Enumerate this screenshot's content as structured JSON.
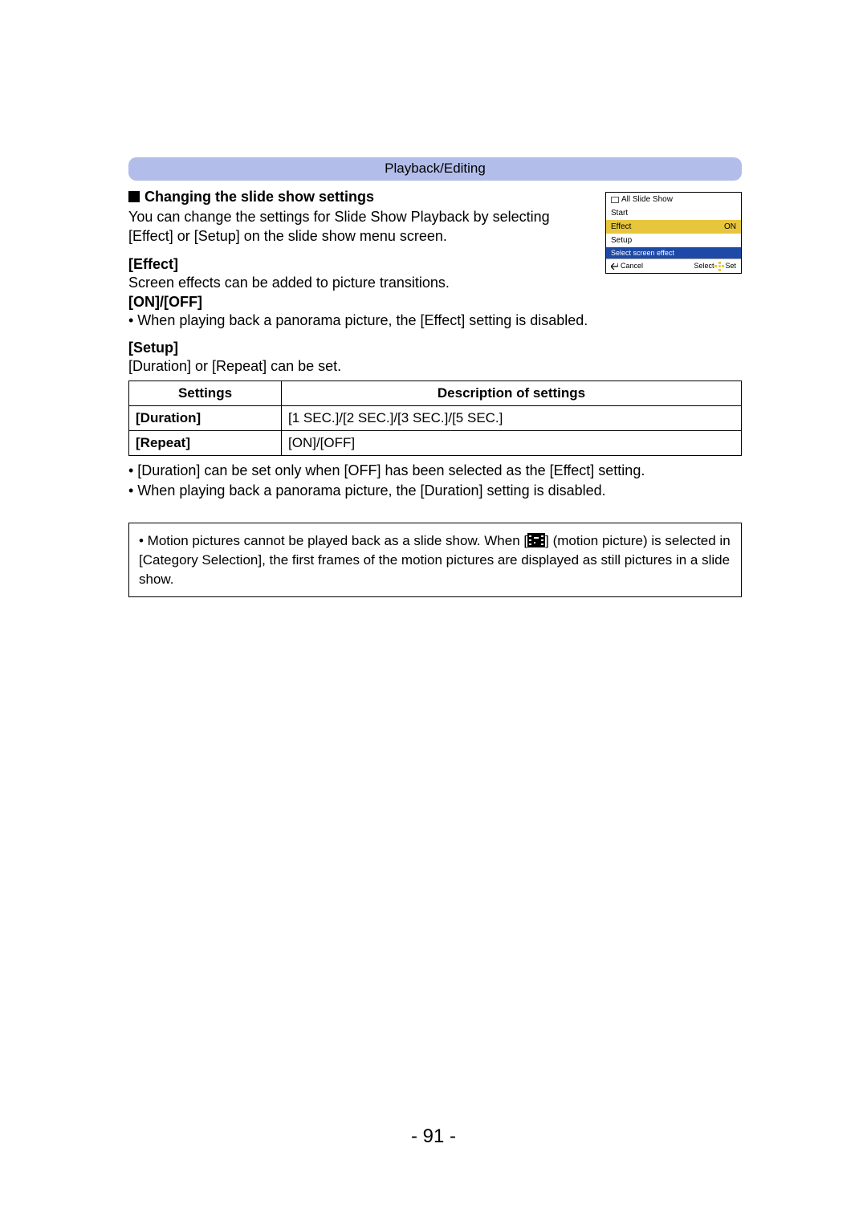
{
  "header": {
    "title": "Playback/Editing"
  },
  "heading1": "Changing the slide show settings",
  "intro": "You can change the settings for Slide Show Playback by selecting [Effect] or [Setup] on the slide show menu screen.",
  "effect": {
    "title": "[Effect]",
    "desc": "Screen effects can be added to picture transitions.",
    "options": "[ON]/[OFF]",
    "note": "• When playing back a panorama picture, the [Effect] setting is disabled."
  },
  "setup": {
    "title": "[Setup]",
    "desc": "[Duration] or [Repeat] can be set."
  },
  "table": {
    "headers": {
      "settings": "Settings",
      "desc": "Description of settings"
    },
    "rows": [
      {
        "name": "[Duration]",
        "desc": "[1 SEC.]/[2 SEC.]/[3 SEC.]/[5 SEC.]"
      },
      {
        "name": "[Repeat]",
        "desc": "[ON]/[OFF]"
      }
    ]
  },
  "post_notes": [
    "• [Duration] can be set only when [OFF] has been selected as the [Effect] setting.",
    "• When playing back a panorama picture, the [Duration] setting is disabled."
  ],
  "note_box": {
    "pre": "• Motion pictures cannot be played back as a slide show. When [",
    "post": "] (motion picture) is selected in [Category Selection], the first frames of the motion pictures are displayed as still pictures in a slide show."
  },
  "screenshot": {
    "title": "All Slide Show",
    "start": "Start",
    "effect_label": "Effect",
    "effect_value": "ON",
    "setup": "Setup",
    "hint": "Select screen effect",
    "cancel": "Cancel",
    "select": "Select",
    "set": "Set"
  },
  "page_number": "- 91 -"
}
